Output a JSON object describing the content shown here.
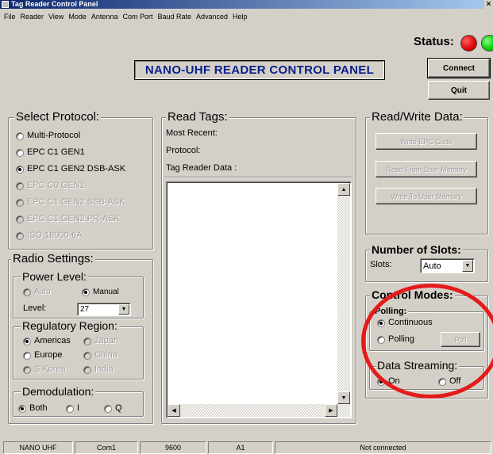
{
  "window": {
    "title": "Tag Reader Control Panel",
    "close_glyph": "×"
  },
  "menu": [
    "File",
    "Reader",
    "View",
    "Mode",
    "Antenna",
    "Com Port",
    "Baud Rate",
    "Advanced",
    "Help"
  ],
  "status": {
    "label": "Status:"
  },
  "banner": "NANO-UHF READER CONTROL PANEL",
  "buttons": {
    "connect": "Connect",
    "quit": "Quit"
  },
  "protocol": {
    "legend": "Select Protocol:",
    "options": [
      {
        "label": "Multi-Protocol",
        "checked": false,
        "enabled": true
      },
      {
        "label": "EPC C1 GEN1",
        "checked": false,
        "enabled": true
      },
      {
        "label": "EPC C1 GEN2 DSB-ASK",
        "checked": true,
        "enabled": true
      },
      {
        "label": "EPC C0 GEN1",
        "checked": false,
        "enabled": false
      },
      {
        "label": "EPC C1 GEN2 SSB-ASK",
        "checked": false,
        "enabled": false
      },
      {
        "label": "EPC C1 GEN2 PR-ASK",
        "checked": false,
        "enabled": false
      },
      {
        "label": "ISO 18000-6A",
        "checked": false,
        "enabled": false
      }
    ]
  },
  "radio_settings": {
    "legend": "Radio Settings:",
    "power": {
      "legend": "Power Level:",
      "auto": "Auto",
      "manual": "Manual",
      "level_label": "Level:",
      "level_value": "27"
    },
    "region": {
      "legend": "Regulatory Region:",
      "americas": "Americas",
      "japan": "Japan",
      "europe": "Europe",
      "china": "China",
      "skorea": "S.Korea",
      "india": "India"
    },
    "demod": {
      "legend": "Demodulation:",
      "both": "Both",
      "i": "I",
      "q": "Q"
    }
  },
  "read_tags": {
    "legend": "Read Tags:",
    "most_recent": "Most Recent:",
    "protocol": "Protocol:",
    "tag_data": "Tag Reader Data :"
  },
  "rw": {
    "legend": "Read/Write Data:",
    "write_epc": "Write EPC Code",
    "read_user": "Read From User Memory",
    "write_user": "Write To User Memory"
  },
  "slots": {
    "legend": "Number of Slots:",
    "label": "Slots:",
    "value": "Auto"
  },
  "control_modes": {
    "legend": "Control Modes:",
    "polling": {
      "legend": "Polling:",
      "continuous": "Continuous",
      "polling": "Polling",
      "poll_button": "Poll"
    },
    "streaming": {
      "legend": "Data Streaming:",
      "on": "On",
      "off": "Off"
    }
  },
  "statusbar": [
    "NANO UHF",
    "Com1",
    "9600",
    "A1",
    "Not connected"
  ],
  "colors": {
    "banner_text": "#0a1e8c",
    "annotation": "#e51a1a",
    "led_red": "#e00000",
    "led_green": "#00cc00"
  }
}
